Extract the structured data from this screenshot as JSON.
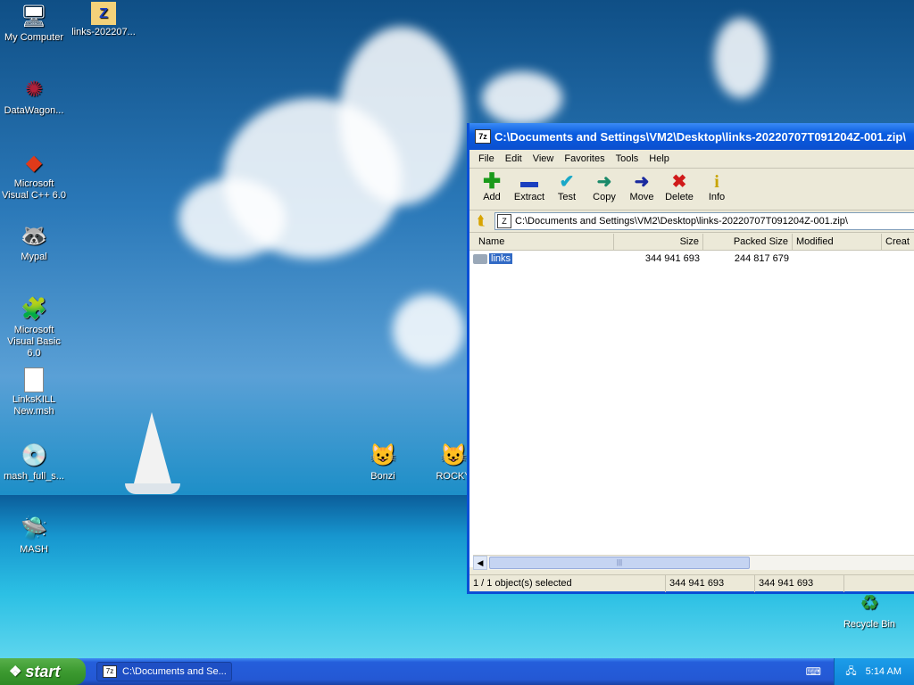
{
  "desktop": {
    "icons": [
      {
        "label": "My Computer",
        "icon": "my-computer-icon"
      },
      {
        "label": "links-202207...",
        "icon": "zip-folder-icon"
      },
      {
        "label": "DataWagon...",
        "icon": "datawagon-icon"
      },
      {
        "label": "Microsoft Visual C++ 6.0",
        "icon": "visual-cpp-icon"
      },
      {
        "label": "Mypal",
        "icon": "mypal-icon"
      },
      {
        "label": "Microsoft Visual Basic 6.0",
        "icon": "visual-basic-icon"
      },
      {
        "label": "LinksKILL New.msh",
        "icon": "document-icon"
      },
      {
        "label": "mash_full_s...",
        "icon": "installer-icon"
      },
      {
        "label": "MASH",
        "icon": "mash-icon"
      },
      {
        "label": "Bonzi",
        "icon": "bonzi-icon"
      },
      {
        "label": "ROCKY",
        "icon": "rocky-icon"
      },
      {
        "label": "Recycle Bin",
        "icon": "recycle-bin-icon"
      }
    ]
  },
  "window": {
    "title": "C:\\Documents and Settings\\VM2\\Desktop\\links-20220707T091204Z-001.zip\\",
    "menu": [
      "File",
      "Edit",
      "View",
      "Favorites",
      "Tools",
      "Help"
    ],
    "toolbar": [
      {
        "label": "Add",
        "glyph": "+",
        "color": "#1a9a1a"
      },
      {
        "label": "Extract",
        "glyph": "—",
        "color": "#1a3fbf"
      },
      {
        "label": "Test",
        "glyph": "✓",
        "color": "#1aa8c8"
      },
      {
        "label": "Copy",
        "glyph": "➜",
        "color": "#1a8a6a"
      },
      {
        "label": "Move",
        "glyph": "➜",
        "color": "#1a2a9f"
      },
      {
        "label": "Delete",
        "glyph": "✕",
        "color": "#d01a1a"
      },
      {
        "label": "Info",
        "glyph": "i",
        "color": "#c8a400"
      }
    ],
    "address": "C:\\Documents and Settings\\VM2\\Desktop\\links-20220707T091204Z-001.zip\\",
    "columns": [
      "Name",
      "Size",
      "Packed Size",
      "Modified",
      "Creat"
    ],
    "rows": [
      {
        "name": "links",
        "size": "344 941 693",
        "packed": "244 817 679",
        "modified": "",
        "created": ""
      }
    ],
    "status": {
      "selected": "1 / 1 object(s) selected",
      "size": "344 941 693",
      "packed": "344 941 693"
    }
  },
  "taskbar": {
    "start_label": "start",
    "task_label": "C:\\Documents and Se...",
    "time": "5:14 AM"
  }
}
